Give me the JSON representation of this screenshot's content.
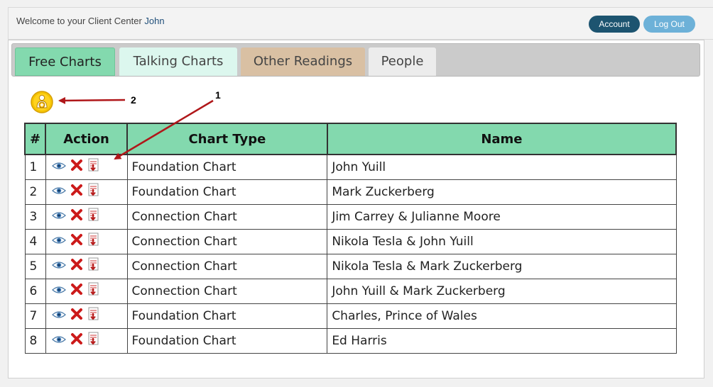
{
  "header": {
    "welcome_text": "Welcome to your Client Center",
    "user_name": "John",
    "account_label": "Account",
    "logout_label": "Log Out"
  },
  "tabs": [
    {
      "label": "Free Charts",
      "active": true
    },
    {
      "label": "Talking Charts"
    },
    {
      "label": "Other Readings"
    },
    {
      "label": "People"
    }
  ],
  "annotations": {
    "label_1": "1",
    "label_2": "2"
  },
  "table": {
    "columns": [
      "#",
      "Action",
      "Chart Type",
      "Name"
    ],
    "rows": [
      {
        "num": "1",
        "type": "Foundation Chart",
        "name": "John Yuill"
      },
      {
        "num": "2",
        "type": "Foundation Chart",
        "name": "Mark Zuckerberg"
      },
      {
        "num": "3",
        "type": "Connection Chart",
        "name": "Jim Carrey & Julianne Moore"
      },
      {
        "num": "4",
        "type": "Connection Chart",
        "name": "Nikola Tesla & John Yuill"
      },
      {
        "num": "5",
        "type": "Connection Chart",
        "name": "Nikola Tesla & Mark Zuckerberg"
      },
      {
        "num": "6",
        "type": "Connection Chart",
        "name": "John Yuill & Mark Zuckerberg"
      },
      {
        "num": "7",
        "type": "Foundation Chart",
        "name": "Charles, Prince of Wales"
      },
      {
        "num": "8",
        "type": "Foundation Chart",
        "name": "Ed Harris"
      }
    ]
  },
  "icons": {
    "view": "eye-icon",
    "delete": "delete-x-icon",
    "pdf": "pdf-download-icon",
    "add": "add-person-icon"
  },
  "colors": {
    "tab_active": "#83d9ae",
    "header_green": "#83d9ae",
    "account_button": "#1d5470",
    "logout_button": "#6db1d8",
    "annotation_arrow": "#b0171a"
  }
}
